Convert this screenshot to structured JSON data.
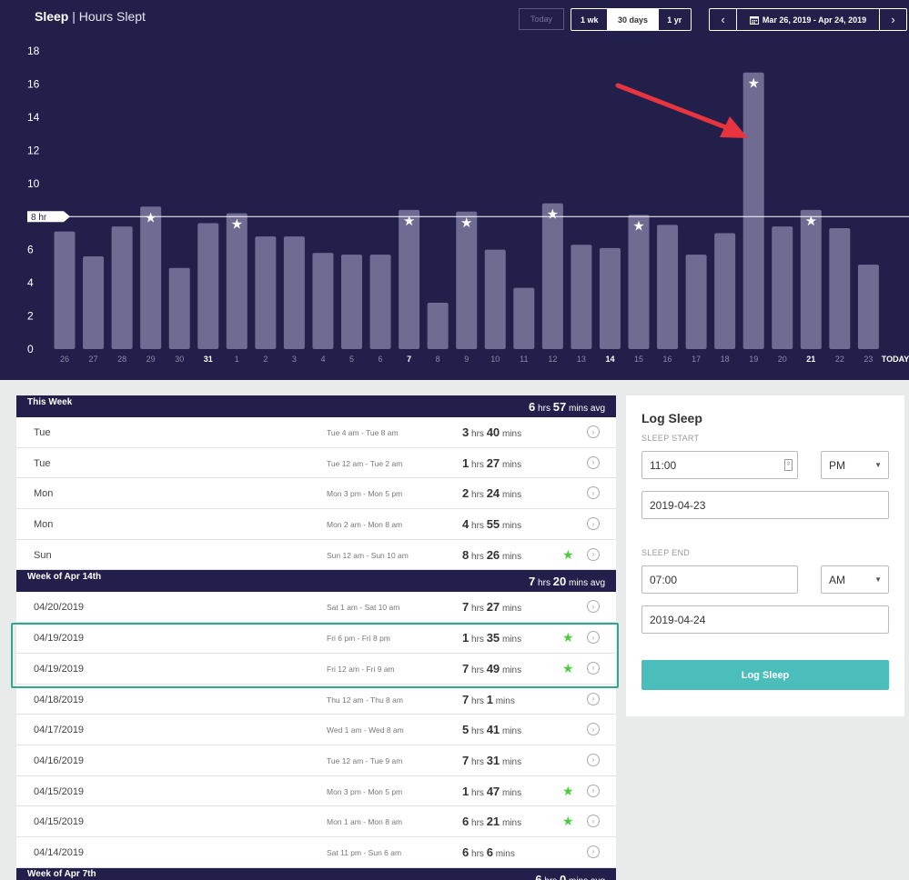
{
  "header": {
    "title_bold": "Sleep",
    "title_rest": "| Hours Slept"
  },
  "controls": {
    "today_label": "Today",
    "range_1wk": "1 wk",
    "range_30d": "30 days",
    "range_1yr": "1 yr",
    "date_range": "Mar 26, 2019 - Apr 24, 2019",
    "prev_icon": "chevron-left-icon",
    "next_icon": "chevron-right-icon",
    "calendar_icon": "calendar-icon"
  },
  "chart_data": {
    "type": "bar",
    "categories": [
      "26",
      "27",
      "28",
      "29",
      "30",
      "31",
      "1",
      "2",
      "3",
      "4",
      "5",
      "6",
      "7",
      "8",
      "9",
      "10",
      "11",
      "12",
      "13",
      "14",
      "15",
      "16",
      "17",
      "18",
      "19",
      "20",
      "21",
      "22",
      "23",
      "TODAY"
    ],
    "bold_categories": [
      "31",
      "7",
      "14",
      "21",
      "TODAY"
    ],
    "values": [
      7.1,
      5.6,
      7.4,
      8.6,
      4.9,
      7.6,
      8.2,
      6.8,
      6.8,
      5.8,
      5.7,
      5.7,
      8.4,
      2.8,
      8.3,
      6.0,
      3.7,
      8.8,
      6.3,
      6.1,
      8.1,
      7.5,
      5.7,
      7.0,
      16.7,
      7.4,
      8.4,
      7.3,
      5.1,
      0
    ],
    "starred": [
      3,
      6,
      12,
      14,
      17,
      20,
      24,
      26
    ],
    "yticks": [
      0,
      2,
      4,
      6,
      8,
      10,
      12,
      14,
      16,
      18
    ],
    "ylim": [
      0,
      18
    ],
    "goal_value": 8,
    "goal_label": "8 hr",
    "colors": {
      "background": "#221f4b",
      "bar": "#6f6b92",
      "goal_line": "#ffffff",
      "arrow": "#e8343e"
    }
  },
  "weeks": [
    {
      "name": "This Week",
      "avg_hrs": "6",
      "avg_hrs_unit": "hrs",
      "avg_mins": "57",
      "avg_mins_unit": "mins avg",
      "rows": [
        {
          "day": "Tue",
          "range": "Tue 4 am - Tue 8 am",
          "hrs": "3",
          "mins": "40",
          "star": false
        },
        {
          "day": "Tue",
          "range": "Tue 12 am - Tue 2 am",
          "hrs": "1",
          "mins": "27",
          "star": false
        },
        {
          "day": "Mon",
          "range": "Mon 3 pm - Mon 5 pm",
          "hrs": "2",
          "mins": "24",
          "star": false
        },
        {
          "day": "Mon",
          "range": "Mon 2 am - Mon 8 am",
          "hrs": "4",
          "mins": "55",
          "star": false
        },
        {
          "day": "Sun",
          "range": "Sun 12 am - Sun 10 am",
          "hrs": "8",
          "mins": "26",
          "star": true
        }
      ]
    },
    {
      "name": "Week of Apr 14th",
      "avg_hrs": "7",
      "avg_hrs_unit": "hrs",
      "avg_mins": "20",
      "avg_mins_unit": "mins avg",
      "rows": [
        {
          "day": "04/20/2019",
          "range": "Sat 1 am - Sat 10 am",
          "hrs": "7",
          "mins": "27",
          "star": false
        },
        {
          "day": "04/19/2019",
          "range": "Fri 6 pm - Fri 8 pm",
          "hrs": "1",
          "mins": "35",
          "star": true
        },
        {
          "day": "04/19/2019",
          "range": "Fri 12 am - Fri 9 am",
          "hrs": "7",
          "mins": "49",
          "star": true
        },
        {
          "day": "04/18/2019",
          "range": "Thu 12 am - Thu 8 am",
          "hrs": "7",
          "mins": "1",
          "star": false
        },
        {
          "day": "04/17/2019",
          "range": "Wed 1 am - Wed 8 am",
          "hrs": "5",
          "mins": "41",
          "star": false
        },
        {
          "day": "04/16/2019",
          "range": "Tue 12 am - Tue 9 am",
          "hrs": "7",
          "mins": "31",
          "star": false
        },
        {
          "day": "04/15/2019",
          "range": "Mon 3 pm - Mon 5 pm",
          "hrs": "1",
          "mins": "47",
          "star": true
        },
        {
          "day": "04/15/2019",
          "range": "Mon 1 am - Mon 8 am",
          "hrs": "6",
          "mins": "21",
          "star": true
        },
        {
          "day": "04/14/2019",
          "range": "Sat 11 pm - Sun 6 am",
          "hrs": "6",
          "mins": "6",
          "star": false
        }
      ]
    },
    {
      "name": "Week of Apr 7th",
      "avg_hrs": "6",
      "avg_hrs_unit": "hrs",
      "avg_mins": "0",
      "avg_mins_unit": "mins avg",
      "rows": []
    }
  ],
  "units": {
    "hrs": "hrs",
    "mins": "mins"
  },
  "log_sleep": {
    "title": "Log Sleep",
    "start_label": "SLEEP START",
    "start_time": "11:00",
    "start_ampm": "PM",
    "start_date": "2019-04-23",
    "end_label": "SLEEP END",
    "end_time": "07:00",
    "end_ampm": "AM",
    "end_date": "2019-04-24",
    "button_label": "Log Sleep"
  }
}
